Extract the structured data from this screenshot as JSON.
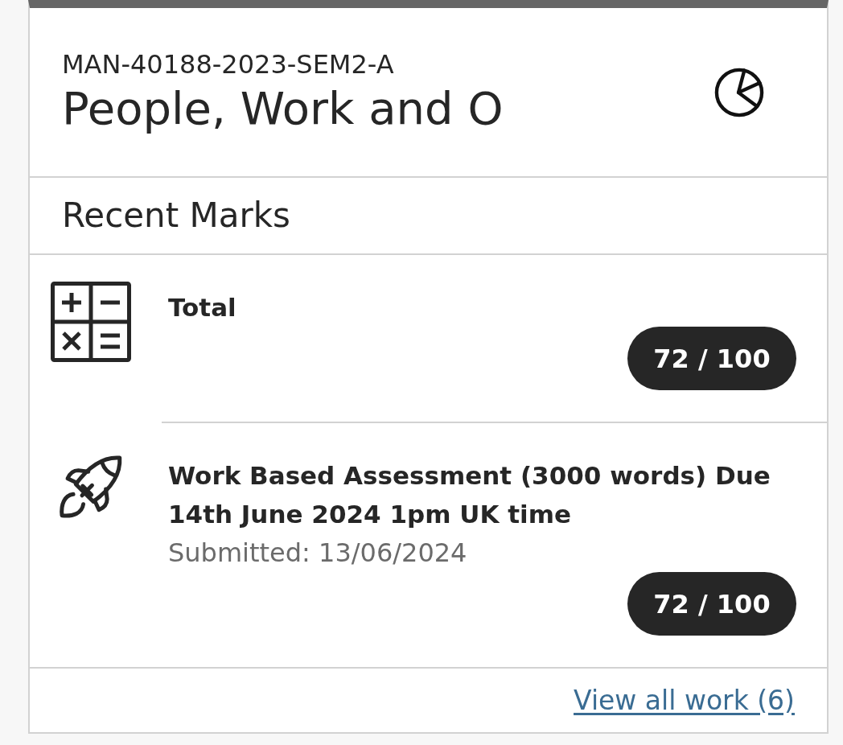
{
  "course": {
    "code": "MAN-40188-2023-SEM2-A",
    "title": "People, Work and O"
  },
  "section": {
    "title": "Recent Marks"
  },
  "items": [
    {
      "kind": "total",
      "title": "Total",
      "score": "72 / 100"
    },
    {
      "kind": "assignment",
      "title": "Work Based Assessment (3000 words) Due 14th June 2024 1pm UK time",
      "submitted": "Submitted: 13/06/2024",
      "score": "72 / 100"
    }
  ],
  "footer": {
    "link": "View all work (6)"
  }
}
